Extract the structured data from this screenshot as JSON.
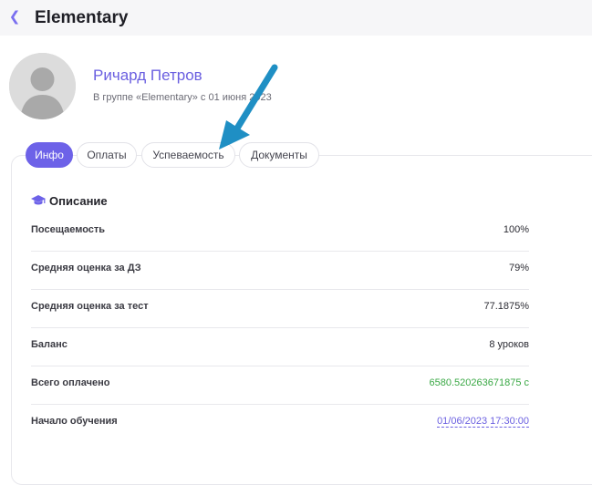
{
  "header": {
    "title": "Elementary",
    "back_icon": "chevron-left-icon"
  },
  "profile": {
    "name": "Ричард Петров",
    "subtitle": "В группе «Elementary» с 01 июня 2023"
  },
  "tabs": [
    {
      "label": "Инфо",
      "active": true
    },
    {
      "label": "Оплаты",
      "active": false
    },
    {
      "label": "Успеваемость",
      "active": false
    },
    {
      "label": "Документы",
      "active": false
    }
  ],
  "section": {
    "title": "Описание",
    "icon": "graduation-cap-icon"
  },
  "rows": [
    {
      "label": "Посещаемость",
      "value": "100%"
    },
    {
      "label": "Средняя оценка за ДЗ",
      "value": "79%"
    },
    {
      "label": "Средняя оценка за тест",
      "value": "77.1875%"
    },
    {
      "label": "Баланс",
      "value": "8 уроков"
    },
    {
      "label": "Всего оплачено",
      "value": "6580.520263671875 с"
    },
    {
      "label": "Начало обучения",
      "value": "01/06/2023 17:30:00"
    }
  ],
  "colors": {
    "accent": "#6d62e8",
    "paid_value": "#3aa845",
    "annotation_arrow": "#1f8fc4"
  }
}
